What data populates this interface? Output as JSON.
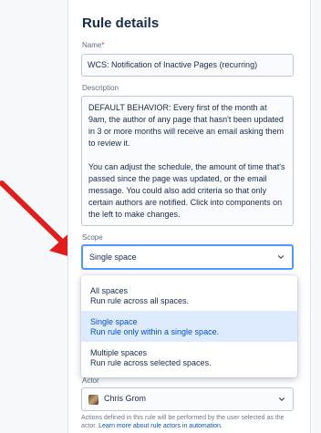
{
  "rule_details": {
    "title": "Rule details",
    "name_label": "Name",
    "required_marker": "*",
    "name_value": "WCS: Notification of Inactive Pages (recurring)",
    "description_label": "Description",
    "description_value": "DEFAULT BEHAVIOR: Every first of the month at 9am, the author of any page that hasn't been updated in 3 or more months will receive an email asking them to review it.\n\nYou can adjust the schedule, the amount of time that's passed since the page was updated, or the email message. You could also add criteria so that only certain authors are notified. Click into components on the left to make changes."
  },
  "scope": {
    "label": "Scope",
    "selected": "Single space",
    "options": [
      {
        "title": "All spaces",
        "subtitle": "Run rule across all spaces."
      },
      {
        "title": "Single space",
        "subtitle": "Run rule only within a single space."
      },
      {
        "title": "Multiple spaces",
        "subtitle": "Run rule across selected spaces."
      }
    ]
  },
  "actor": {
    "label": "Actor",
    "value": "Chris Grom",
    "note_text": "Actions defined in this rule will be performed by the user selected as the actor.",
    "note_link": "Learn more about rule actors in automation."
  },
  "colors": {
    "accent": "#0052cc",
    "selected_bg": "#deebff",
    "arrow": "#e01e1e",
    "focus_border": "#4c9aff"
  },
  "icons": {
    "dropdown": "chevron-down-icon",
    "arrow": "red-arrow-annotation"
  }
}
